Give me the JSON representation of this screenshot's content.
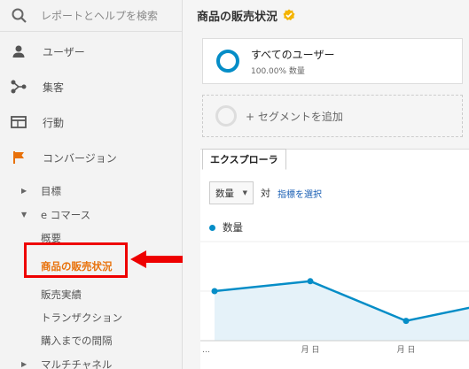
{
  "search": {
    "placeholder": "レポートとヘルプを検索"
  },
  "nav": {
    "users": "ユーザー",
    "acquisition": "集客",
    "behavior": "行動",
    "conversions": "コンバージョン"
  },
  "conversions_sub": {
    "goals": "目標",
    "ecommerce": "e コマース",
    "ecommerce_items": [
      "概要",
      "商品の販売状況",
      "販売実績",
      "トランザクション",
      "購入までの間隔"
    ],
    "multichannel": "マルチチャネル"
  },
  "page": {
    "title": "商品の販売状況"
  },
  "segment": {
    "name": "すべてのユーザー",
    "share": "100.00% 数量",
    "add_label": "+ セグメントを追加"
  },
  "explorer": {
    "tab_label": "エクスプローラ",
    "metric_select": "数量",
    "vs_label": "対",
    "pick_metric_label": "指標を選択"
  },
  "colors": {
    "accent_orange": "#e8710a",
    "series_blue": "#058dc7",
    "highlight_red": "#e00000"
  },
  "chart_data": {
    "type": "line",
    "series": [
      {
        "name": "数量",
        "values": [
          5,
          6,
          2,
          4
        ]
      }
    ],
    "x": [
      "…",
      "月 日",
      "月 日",
      ""
    ],
    "ylim": [
      0,
      10
    ],
    "grid": true
  }
}
